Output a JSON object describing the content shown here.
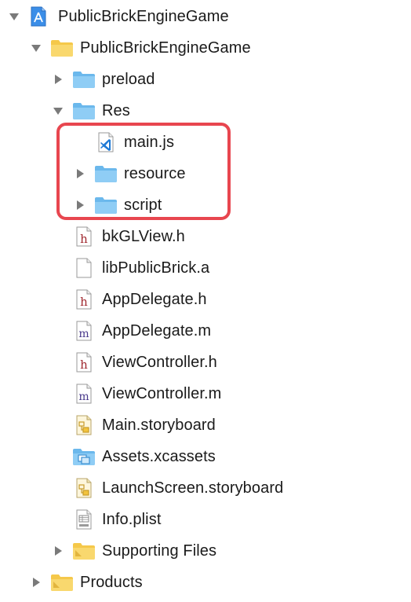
{
  "navigator": {
    "items": [
      {
        "label": "PublicBrickEngineGame",
        "icon": "xcode-project-icon",
        "disclosure": "expanded"
      },
      {
        "label": "PublicBrickEngineGame",
        "icon": "yellow-folder-icon",
        "disclosure": "expanded"
      },
      {
        "label": "preload",
        "icon": "blue-folder-icon",
        "disclosure": "collapsed"
      },
      {
        "label": "Res",
        "icon": "blue-folder-icon",
        "disclosure": "expanded"
      },
      {
        "label": "main.js",
        "icon": "vscode-js-file-icon",
        "disclosure": "none"
      },
      {
        "label": "resource",
        "icon": "blue-folder-icon",
        "disclosure": "collapsed"
      },
      {
        "label": "script",
        "icon": "blue-folder-icon",
        "disclosure": "collapsed"
      },
      {
        "label": "bkGLView.h",
        "icon": "header-file-icon",
        "disclosure": "none"
      },
      {
        "label": "libPublicBrick.a",
        "icon": "blank-file-icon",
        "disclosure": "none"
      },
      {
        "label": "AppDelegate.h",
        "icon": "header-file-icon",
        "disclosure": "none"
      },
      {
        "label": "AppDelegate.m",
        "icon": "objc-source-file-icon",
        "disclosure": "none"
      },
      {
        "label": "ViewController.h",
        "icon": "header-file-icon",
        "disclosure": "none"
      },
      {
        "label": "ViewController.m",
        "icon": "objc-source-file-icon",
        "disclosure": "none"
      },
      {
        "label": "Main.storyboard",
        "icon": "storyboard-file-icon",
        "disclosure": "none"
      },
      {
        "label": "Assets.xcassets",
        "icon": "asset-catalog-icon",
        "disclosure": "none"
      },
      {
        "label": "LaunchScreen.storyboard",
        "icon": "storyboard-file-icon",
        "disclosure": "none"
      },
      {
        "label": "Info.plist",
        "icon": "plist-file-icon",
        "disclosure": "none"
      },
      {
        "label": "Supporting Files",
        "icon": "yellow-group-folder-icon",
        "disclosure": "collapsed"
      },
      {
        "label": "Products",
        "icon": "yellow-group-folder-icon",
        "disclosure": "collapsed"
      }
    ]
  },
  "colors": {
    "highlight_border": "#e8464f",
    "blue_folder": "#7cc4f2",
    "yellow_folder": "#f7ce5a",
    "disclosure": "#7a7a7a",
    "label_text": "#1a1a1a"
  }
}
